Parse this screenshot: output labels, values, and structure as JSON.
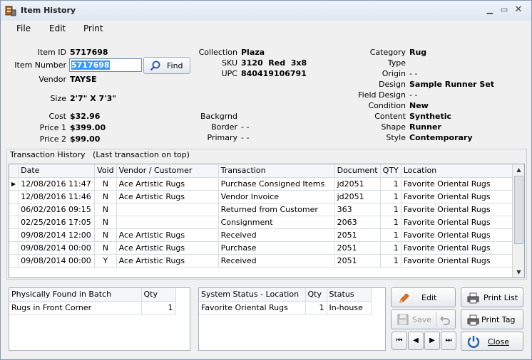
{
  "window": {
    "title": "Item History"
  },
  "menu": [
    "File",
    "Edit",
    "Print"
  ],
  "item": {
    "id_label": "Item ID",
    "id": "5717698",
    "number_label": "Item Number",
    "number": "5717698",
    "find_label": "Find",
    "vendor_label": "Vendor",
    "vendor": "TAYSE",
    "size_label": "Size",
    "size": "2'7\" X 7'3\"",
    "cost_label": "Cost",
    "cost": "$32.96",
    "price1_label": "Price 1",
    "price1": "$399.00",
    "price2_label": "Price 2",
    "price2": "$99.00",
    "collection_label": "Collection",
    "collection": "Plaza",
    "sku_label": "SKU",
    "sku": "3120  Red  3x8",
    "upc_label": "UPC",
    "upc": "840419106791",
    "backgrnd_label": "Backgrnd",
    "backgrnd": "",
    "border_label": "Border",
    "border": "- -",
    "primary_label": "Primary",
    "primary": "- -",
    "category_label": "Category",
    "category": "Rug",
    "type_label": "Type",
    "type": "",
    "origin_label": "Origin",
    "origin": "- -",
    "design_label": "Design",
    "design": "Sample Runner Set",
    "field_design_label": "Field Design",
    "field_design": "- -",
    "condition_label": "Condition",
    "condition": "New",
    "content_label": "Content",
    "content": "Synthetic",
    "shape_label": "Shape",
    "shape": "Runner",
    "style_label": "Style",
    "style": "Contemporary"
  },
  "transactions": {
    "title": "Transaction History   (Last transaction on top)",
    "columns": [
      "Date",
      "Void",
      "Vendor / Customer",
      "Transaction",
      "Document",
      "QTY",
      "Location"
    ],
    "rows": [
      [
        "12/08/2016 11:47",
        "N",
        "Ace Artistic Rugs",
        "Purchase Consigned Items",
        "jd2051",
        "1",
        "Favorite Oriental Rugs"
      ],
      [
        "12/08/2016 11:46",
        "N",
        "Ace Artistic Rugs",
        "Vendor Invoice",
        "jd2051",
        "1",
        "Favorite Oriental Rugs"
      ],
      [
        "06/02/2016 09:15",
        "N",
        "",
        "Returned from Customer",
        "363",
        "1",
        "Favorite Oriental Rugs"
      ],
      [
        "02/25/2016 17:05",
        "N",
        "",
        "Consignment",
        "2063",
        "1",
        "Favorite Oriental Rugs"
      ],
      [
        "09/08/2014 12:00",
        "N",
        "Ace Artistic Rugs",
        "Received",
        "2051",
        "1",
        "Favorite Oriental Rugs"
      ],
      [
        "09/08/2014 00:00",
        "N",
        "Ace Artistic Rugs",
        "Purchase",
        "2051",
        "1",
        "Favorite Oriental Rugs"
      ],
      [
        "09/08/2014 00:00",
        "Y",
        "Ace Artistic Rugs",
        "Received",
        "2051",
        "1",
        "Favorite Oriental Rugs"
      ]
    ]
  },
  "batch": {
    "columns": [
      "Physically Found in Batch",
      "Qty"
    ],
    "rows": [
      [
        "Rugs in Front Corner",
        "1"
      ]
    ]
  },
  "system_status": {
    "columns": [
      "System Status - Location",
      "Qty",
      "Status"
    ],
    "rows": [
      [
        "Favorite Oriental Rugs",
        "1",
        "In-house"
      ]
    ]
  },
  "buttons": {
    "edit": "Edit",
    "save": "Save",
    "print_list": "Print List",
    "print_tag": "Print Tag",
    "close": "Close"
  }
}
